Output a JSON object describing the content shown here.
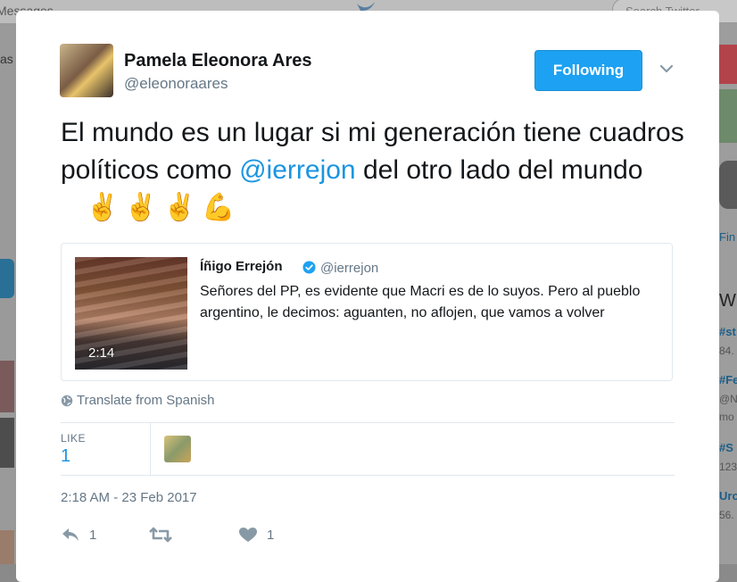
{
  "background": {
    "messages_label": "Messages",
    "search_placeholder": "Search Twitter",
    "left_fragment": "as",
    "right_fragments": [
      {
        "text": "Fin",
        "kind": "link"
      },
      {
        "text": "W",
        "kind": "heading"
      },
      {
        "text": "#st",
        "kind": "link"
      },
      {
        "text": "84.",
        "kind": "meta"
      },
      {
        "text": "#Fe",
        "kind": "link"
      },
      {
        "text": "@N",
        "kind": "meta"
      },
      {
        "text": "mo",
        "kind": "meta"
      },
      {
        "text": "#S",
        "kind": "link"
      },
      {
        "text": "123",
        "kind": "meta"
      },
      {
        "text": "Uro",
        "kind": "link"
      },
      {
        "text": "56.",
        "kind": "meta"
      }
    ]
  },
  "tweet": {
    "author_name": "Pamela Eleonora Ares",
    "author_handle": "@eleonoraares",
    "follow_label": "Following",
    "text_before": "El mundo es un lugar si mi generación tiene cuadros políticos como ",
    "mention": "@ierrejon",
    "text_after": " del otro lado del mundo",
    "emojis": "✌✌✌💪",
    "quote": {
      "name": "Íñigo Errejón",
      "handle": "@ierrejon",
      "text": "Señores del PP, es evidente que Macri es de lo suyos. Pero al pueblo argentino, le decimos: aguanten, no aflojen, que vamos a volver",
      "video_duration": "2:14"
    },
    "translate_label": "Translate from Spanish",
    "like_label": "LIKE",
    "like_count": "1",
    "timestamp": "2:18 AM - 23 Feb 2017",
    "actions": {
      "reply_count": "1",
      "retweet_count": "",
      "like_count": "1"
    }
  },
  "colors": {
    "accent": "#1da1f2",
    "link": "#1b95e0",
    "muted": "#657786",
    "text": "#14171a",
    "border": "#e1e8ed"
  }
}
